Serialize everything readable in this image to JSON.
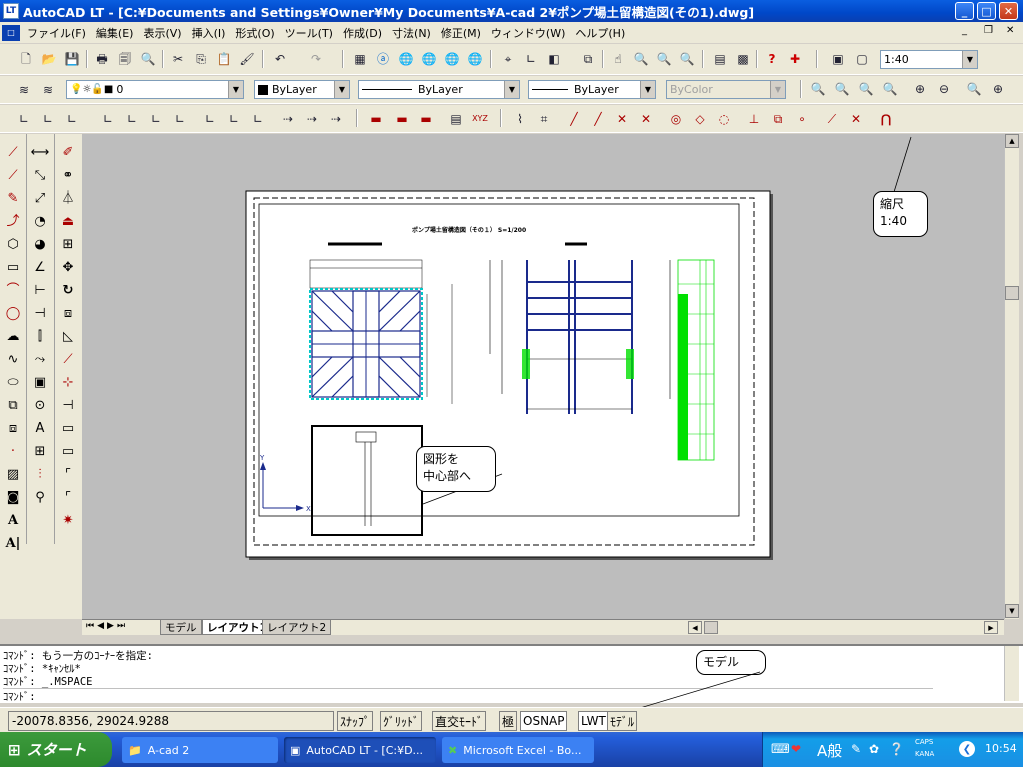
{
  "window": {
    "title": "AutoCAD LT - [C:¥Documents and Settings¥Owner¥My Documents¥A-cad 2¥ポンプ場土留構造図(その1).dwg]",
    "app_icon": "LT",
    "minimize": "_",
    "maximize": "□",
    "close": "✕"
  },
  "menu": [
    "ファイル(F)",
    "編集(E)",
    "表示(V)",
    "挿入(I)",
    "形式(O)",
    "ツール(T)",
    "作成(D)",
    "寸法(N)",
    "修正(M)",
    "ウィンドウ(W)",
    "ヘルプ(H)"
  ],
  "menu_controls": {
    "minimize": "_",
    "restore": "❐",
    "close": "✕"
  },
  "toolbar": {
    "scale_value": "1:40",
    "layer_value": "0",
    "color_value": "ByLayer",
    "linetype_value": "ByLayer",
    "lineweight_value": "ByLayer",
    "plotstyle_value": "ByColor"
  },
  "drawing": {
    "title": "ポンプ場土留構造図（その１）  S=1/200"
  },
  "callouts": {
    "scale_note": [
      "縮尺",
      "1:40"
    ],
    "center_note": [
      "図形を",
      "中心部へ"
    ],
    "model_note": "モデル"
  },
  "tabs": [
    "モデル",
    "レイアウト1",
    "レイアウト2"
  ],
  "active_tab": "レイアウト1",
  "command_lines": [
    "ｺﾏﾝﾄﾞ: もう一方のｺｰﾅｰを指定:",
    "ｺﾏﾝﾄﾞ: *ｷｬﾝｾﾙ*",
    "ｺﾏﾝﾄﾞ: _.MSPACE",
    "ｺﾏﾝﾄﾞ:"
  ],
  "status": {
    "coords": "-20078.8356, 29024.9288",
    "buttons": [
      "ｽﾅｯﾌﾟ",
      "ｸﾞﾘｯﾄﾞ",
      "直交ﾓｰﾄﾞ",
      "極",
      "OSNAP",
      "LWT",
      "ﾓﾃﾞﾙ"
    ]
  },
  "taskbar": {
    "start": "スタート",
    "tasks": [
      "A-cad 2",
      "AutoCAD LT - [C:¥D...",
      "Microsoft Excel - Bo..."
    ],
    "ime": "A般",
    "caps": "CAPS",
    "kana": "KANA",
    "clock": "10:54"
  },
  "colors": {
    "titlebar": "#0047c8",
    "canvas": "#bdbdbd",
    "drawing_blue": "#1a2a8c",
    "drawing_cyan": "#00c8c8",
    "drawing_green": "#00e000",
    "taskbar": "#245edb",
    "start": "#2d8a2d"
  }
}
